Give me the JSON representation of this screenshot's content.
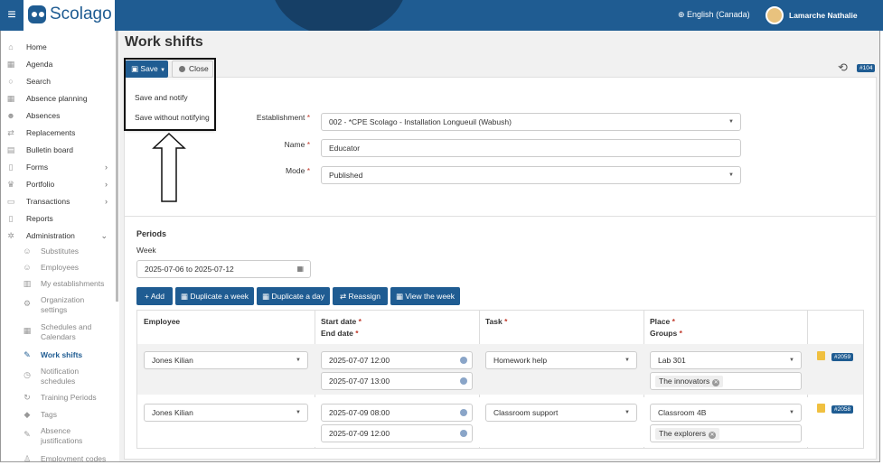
{
  "header": {
    "logo_text": "Scolago",
    "language": "English (Canada)",
    "user": "Lamarche Nathalie"
  },
  "sidebar": {
    "items": [
      {
        "label": "Home",
        "icon": "home-icon"
      },
      {
        "label": "Agenda",
        "icon": "calendar-icon"
      },
      {
        "label": "Search",
        "icon": "search-icon"
      },
      {
        "label": "Absence planning",
        "icon": "calendar-icon"
      },
      {
        "label": "Absences",
        "icon": "user-absence-icon"
      },
      {
        "label": "Replacements",
        "icon": "swap-icon"
      },
      {
        "label": "Bulletin board",
        "icon": "bulletin-icon"
      },
      {
        "label": "Forms",
        "icon": "document-icon"
      },
      {
        "label": "Portfolio",
        "icon": "trophy-icon"
      },
      {
        "label": "Transactions",
        "icon": "card-icon"
      },
      {
        "label": "Reports",
        "icon": "report-icon"
      },
      {
        "label": "Administration",
        "icon": "gear-icon"
      }
    ],
    "sub_items": [
      {
        "label": "Substitutes"
      },
      {
        "label": "Employees"
      },
      {
        "label": "My establishments"
      },
      {
        "label": "Organization settings"
      },
      {
        "label": "Schedules and Calendars"
      },
      {
        "label": "Work shifts"
      },
      {
        "label": "Notification schedules"
      },
      {
        "label": "Training Periods"
      },
      {
        "label": "Tags"
      },
      {
        "label": "Absence justifications"
      },
      {
        "label": "Employment codes"
      }
    ]
  },
  "page": {
    "title": "Work shifts",
    "record_badge": "#104"
  },
  "toolbar": {
    "save_label": "Save",
    "close_label": "Close",
    "save_menu": [
      "Save and notify",
      "Save without notifying"
    ]
  },
  "form": {
    "establishment_label": "Establishment",
    "establishment_value": "002 - *CPE Scolago - Installation Longueuil (Wabush)",
    "name_label": "Name",
    "name_value": "Educator",
    "mode_label": "Mode",
    "mode_value": "Published"
  },
  "periods": {
    "title": "Periods",
    "week_label": "Week",
    "week_value": "2025-07-06 to 2025-07-12",
    "buttons": {
      "add": "Add",
      "duplicate_week": "Duplicate a week",
      "duplicate_day": "Duplicate a day",
      "reassign": "Reassign",
      "view_week": "View the week"
    },
    "columns": {
      "employee": "Employee",
      "start_date": "Start date",
      "end_date": "End date",
      "task": "Task",
      "place": "Place",
      "groups": "Groups"
    },
    "rows": [
      {
        "employee": "Jones Kilian",
        "start": "2025-07-07 12:00",
        "end": "2025-07-07 13:00",
        "task": "Homework help",
        "place": "Lab 301",
        "group": "The innovators",
        "id": "#2059"
      },
      {
        "employee": "Jones Kilian",
        "start": "2025-07-09 08:00",
        "end": "2025-07-09 12:00",
        "task": "Classroom support",
        "place": "Classroom 4B",
        "group": "The explorers",
        "id": "#2058"
      }
    ]
  }
}
